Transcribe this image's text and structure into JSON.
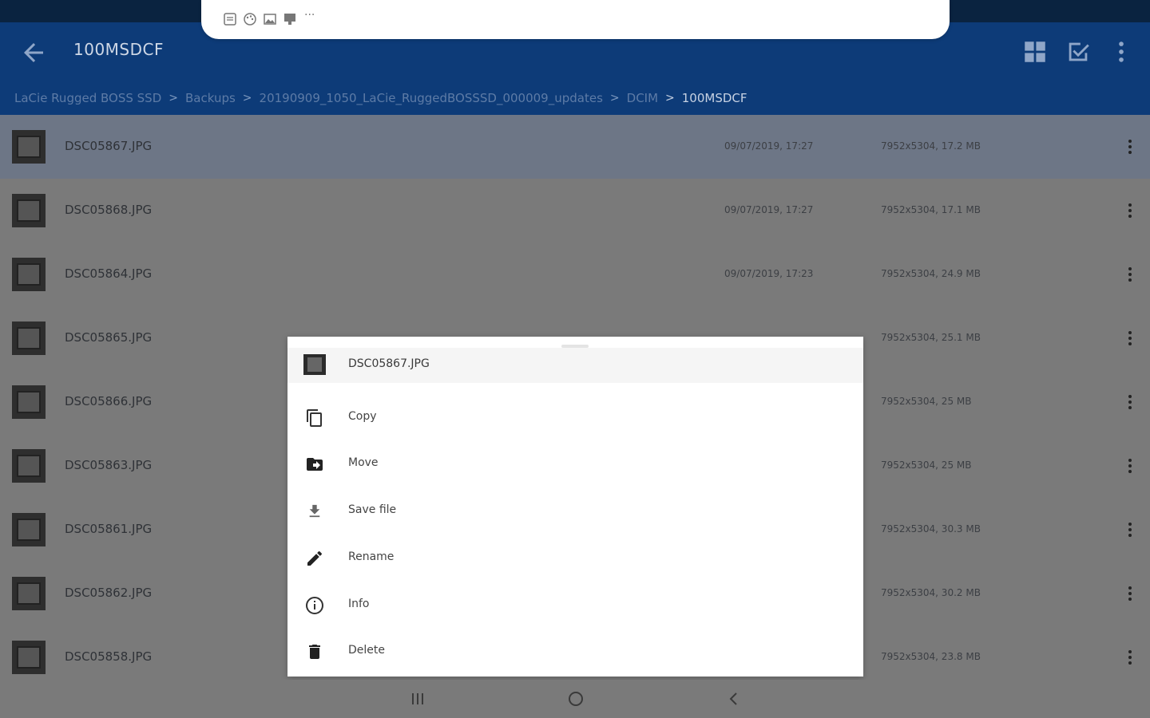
{
  "appbar": {
    "title": "100MSDCF",
    "breadcrumb": [
      "LaCie Rugged BOSS SSD",
      "Backups",
      "20190909_1050_LaCie_RuggedBOSSSD_000009_updates",
      "DCIM",
      "100MSDCF"
    ],
    "actions": [
      "grid-view-icon",
      "select-check-icon",
      "more-vert-icon"
    ]
  },
  "floating_toolbar": {
    "icons": [
      "document-icon",
      "palette-icon",
      "image-icon",
      "display-icon",
      "ellipsis-icon"
    ],
    "more_label": "···"
  },
  "files": [
    {
      "name": "DSC05867.JPG",
      "date": "09/07/2019, 17:27",
      "size": "7952x5304, 17.2 MB",
      "selected": true
    },
    {
      "name": "DSC05868.JPG",
      "date": "09/07/2019, 17:27",
      "size": "7952x5304, 17.1 MB"
    },
    {
      "name": "DSC05864.JPG",
      "date": "09/07/2019, 17:23",
      "size": "7952x5304, 24.9 MB"
    },
    {
      "name": "DSC05865.JPG",
      "date": "",
      "size": "7952x5304, 25.1 MB"
    },
    {
      "name": "DSC05866.JPG",
      "date": "",
      "size": "7952x5304, 25 MB"
    },
    {
      "name": "DSC05863.JPG",
      "date": "",
      "size": "7952x5304, 25 MB"
    },
    {
      "name": "DSC05861.JPG",
      "date": "",
      "size": "7952x5304, 30.3 MB"
    },
    {
      "name": "DSC05862.JPG",
      "date": "",
      "size": "7952x5304, 30.2 MB"
    },
    {
      "name": "DSC05858.JPG",
      "date": "",
      "size": "7952x5304, 23.8 MB"
    }
  ],
  "sheet": {
    "file_name": "DSC05867.JPG",
    "items": [
      {
        "label": "Copy",
        "icon": "copy-icon"
      },
      {
        "label": "Move",
        "icon": "move-folder-icon"
      },
      {
        "label": "Save file",
        "icon": "download-icon"
      },
      {
        "label": "Rename",
        "icon": "pencil-icon"
      },
      {
        "label": "Info",
        "icon": "info-icon"
      },
      {
        "label": "Delete",
        "icon": "trash-icon"
      }
    ]
  },
  "navbar": {
    "buttons": [
      "recent-apps-icon",
      "home-icon",
      "back-nav-icon"
    ]
  }
}
